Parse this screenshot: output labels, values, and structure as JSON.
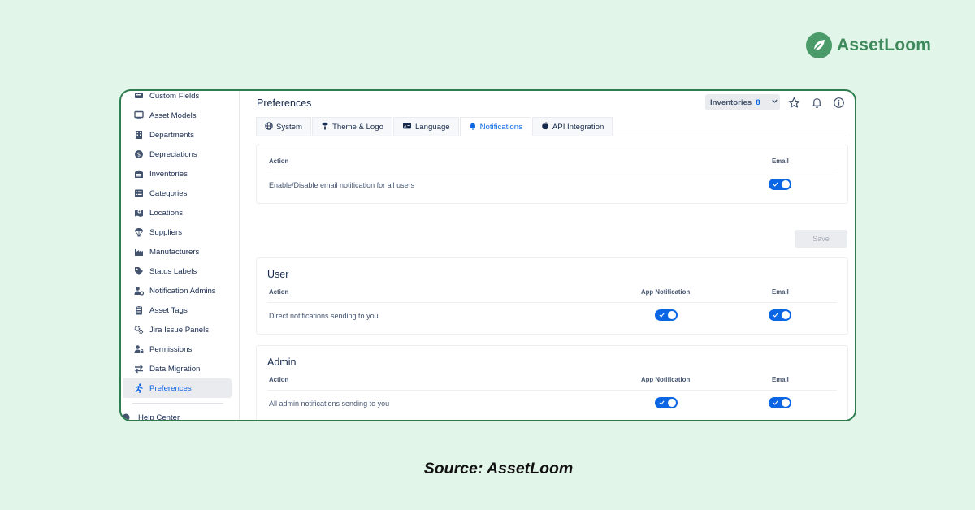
{
  "brand": {
    "name": "AssetLoom"
  },
  "caption": "Source: AssetLoom",
  "sidebar": {
    "items": [
      {
        "label": "Custom Fields",
        "icon": "custom-fields-icon"
      },
      {
        "label": "Asset Models",
        "icon": "monitor-icon"
      },
      {
        "label": "Departments",
        "icon": "building-icon"
      },
      {
        "label": "Depreciations",
        "icon": "coin-icon"
      },
      {
        "label": "Inventories",
        "icon": "warehouse-icon"
      },
      {
        "label": "Categories",
        "icon": "list-icon"
      },
      {
        "label": "Locations",
        "icon": "map-icon"
      },
      {
        "label": "Suppliers",
        "icon": "parachute-icon"
      },
      {
        "label": "Manufacturers",
        "icon": "factory-icon"
      },
      {
        "label": "Status Labels",
        "icon": "tag-icon"
      },
      {
        "label": "Notification Admins",
        "icon": "user-gear-icon"
      },
      {
        "label": "Asset Tags",
        "icon": "clipboard-icon"
      },
      {
        "label": "Jira Issue Panels",
        "icon": "gears-icon"
      },
      {
        "label": "Permissions",
        "icon": "user-lock-icon"
      },
      {
        "label": "Data Migration",
        "icon": "arrows-swap-icon"
      },
      {
        "label": "Preferences",
        "icon": "running-person-icon",
        "active": true
      }
    ],
    "help_label": "Help Center"
  },
  "header": {
    "title": "Preferences",
    "inventories_label": "Inventories",
    "inventories_count": "8"
  },
  "tabs": [
    {
      "label": "System",
      "icon": "globe-icon"
    },
    {
      "label": "Theme & Logo",
      "icon": "paint-roller-icon"
    },
    {
      "label": "Language",
      "icon": "language-icon"
    },
    {
      "label": "Notifications",
      "icon": "bell-icon",
      "active": true
    },
    {
      "label": "API Integration",
      "icon": "apple-icon"
    }
  ],
  "global_card": {
    "col_action": "Action",
    "col_email": "Email",
    "row": {
      "label": "Enable/Disable email notification for all users",
      "email_on": true
    }
  },
  "save_label": "Save",
  "user_card": {
    "title": "User",
    "col_action": "Action",
    "col_app": "App Notification",
    "col_email": "Email",
    "row": {
      "label": "Direct notifications sending to you",
      "app_on": true,
      "email_on": true
    }
  },
  "admin_card": {
    "title": "Admin",
    "col_action": "Action",
    "col_app": "App Notification",
    "col_email": "Email",
    "row": {
      "label": "All admin notifications sending to you",
      "app_on": true,
      "email_on": true
    }
  },
  "colors": {
    "accent": "#0c66e4",
    "frame": "#2e7d4f",
    "background": "#e1f5e8",
    "brand": "#3f8a5c"
  }
}
